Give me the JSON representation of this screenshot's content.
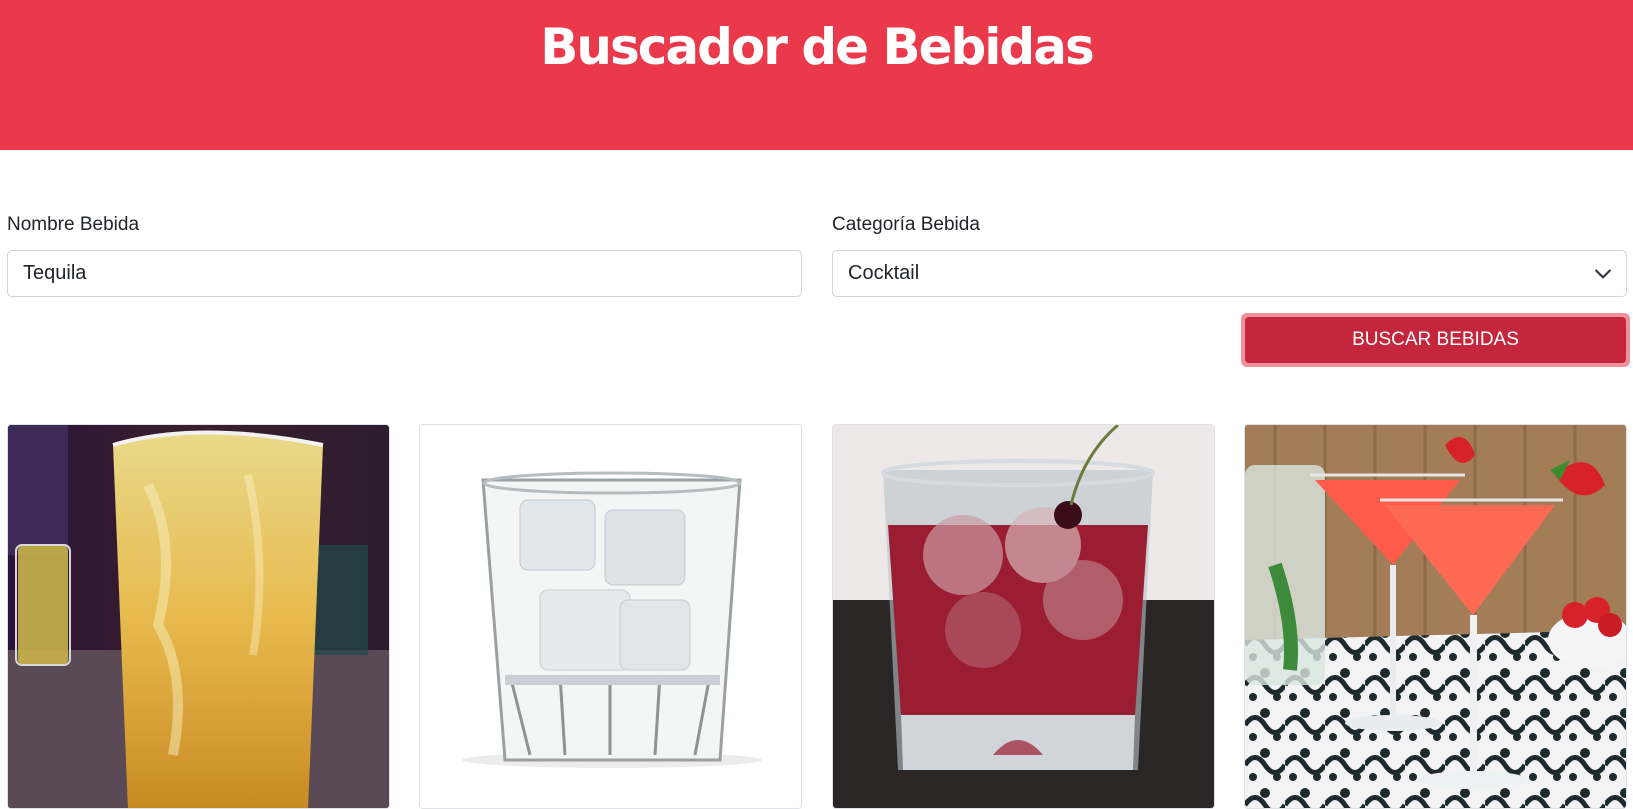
{
  "header": {
    "title": "Buscador de Bebidas"
  },
  "form": {
    "name_label": "Nombre Bebida",
    "name_value": "Tequila",
    "category_label": "Categoría Bebida",
    "category_value": "Cocktail",
    "search_button": "BUSCAR BEBIDAS"
  },
  "results": [
    {
      "image": "orange-cocktail-photo"
    },
    {
      "image": "clear-drink-ice-photo"
    },
    {
      "image": "red-drink-cherry-photo"
    },
    {
      "image": "strawberry-martini-photo"
    }
  ],
  "colors": {
    "brand": "#e9394b",
    "button": "#c4263b"
  }
}
